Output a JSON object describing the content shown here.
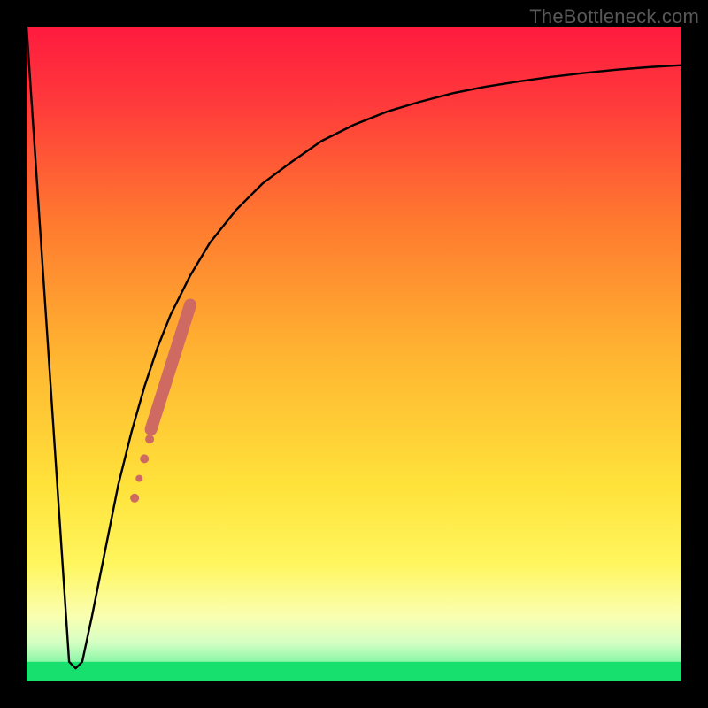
{
  "watermark": "TheBottleneck.com",
  "chart_data": {
    "type": "line",
    "title": "",
    "xlabel": "",
    "ylabel": "",
    "xlim": [
      0,
      100
    ],
    "ylim": [
      0,
      100
    ],
    "grid": false,
    "legend": false,
    "series": [
      {
        "name": "curve",
        "color": "#000000",
        "x": [
          0,
          6.5,
          7.5,
          8.5,
          10,
          12,
          14,
          16,
          18,
          20,
          22,
          25,
          28,
          32,
          36,
          40,
          45,
          50,
          55,
          60,
          65,
          70,
          75,
          80,
          85,
          90,
          95,
          100
        ],
        "y": [
          100,
          3,
          2,
          3,
          10,
          20,
          30,
          38,
          45,
          51,
          56,
          62,
          67,
          72,
          76,
          79,
          82.5,
          85,
          87,
          88.5,
          89.8,
          90.8,
          91.6,
          92.3,
          92.9,
          93.4,
          93.8,
          94.1
        ]
      }
    ],
    "markers": {
      "name": "highlight-segment",
      "color": "#cf6a63",
      "points": [
        {
          "x": 16.5,
          "y": 28,
          "r": 5
        },
        {
          "x": 17.2,
          "y": 31,
          "r": 4
        },
        {
          "x": 18.0,
          "y": 34,
          "r": 5
        },
        {
          "x": 18.8,
          "y": 37,
          "r": 5
        }
      ],
      "thick_segment": {
        "x1": 19.0,
        "y1": 38.5,
        "x2": 25.0,
        "y2": 57.5
      }
    },
    "green_band": {
      "y0": 0,
      "y1": 3
    }
  }
}
